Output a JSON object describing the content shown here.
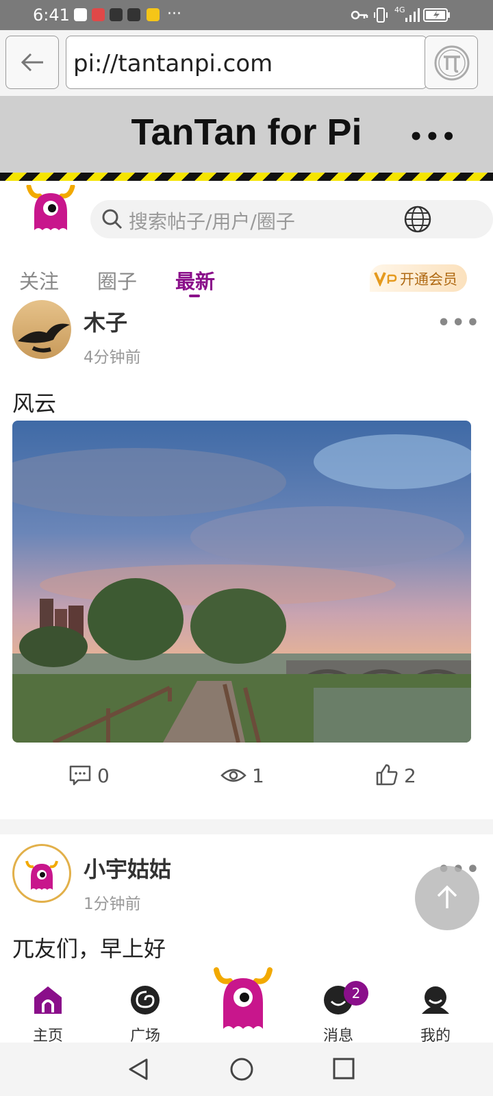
{
  "status_bar": {
    "time": "6:41",
    "network": "4G",
    "notification_dots": "···"
  },
  "browser": {
    "url": "pi://tantanpi.com"
  },
  "app": {
    "title": "TanTan for Pi",
    "more": "•••"
  },
  "search": {
    "placeholder": "搜索帖子/用户/圈子"
  },
  "tabs": [
    {
      "label": "关注",
      "active": false
    },
    {
      "label": "圈子",
      "active": false
    },
    {
      "label": "最新",
      "active": true
    }
  ],
  "vip": {
    "label": "开通会员"
  },
  "posts": [
    {
      "username": "木子",
      "time": "4分钟前",
      "text": "风云",
      "comments": "0",
      "views": "1",
      "likes": "2"
    },
    {
      "username": "小宇姑姑",
      "time": "1分钟前",
      "text": "兀友们，早上好"
    }
  ],
  "bottom_nav": [
    {
      "label": "主页"
    },
    {
      "label": "广场"
    },
    {
      "label": ""
    },
    {
      "label": "消息",
      "badge": "2"
    },
    {
      "label": "我的"
    }
  ],
  "colors": {
    "accent": "#8a0f8a",
    "hazard_black": "#111111",
    "hazard_yellow": "#f5e400"
  }
}
